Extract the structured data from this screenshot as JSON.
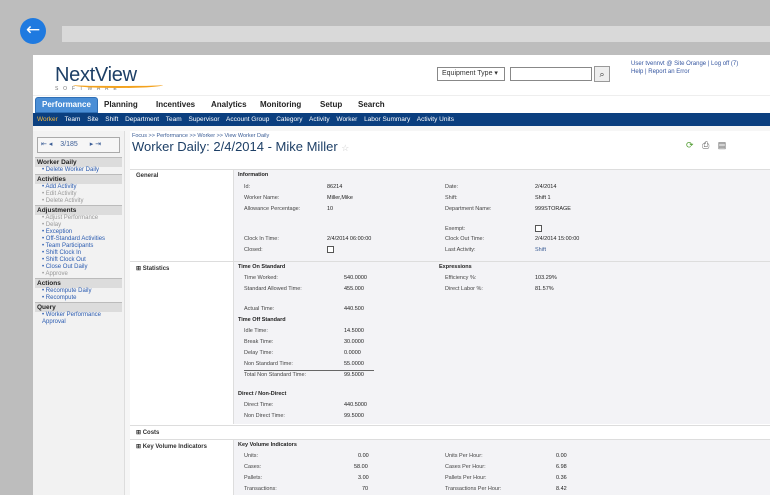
{
  "app": {
    "logo": "NextView",
    "logo_sub": "SOFTWARE",
    "equipment_select": "Equipment Type",
    "user_line1": "User tvennvt @ Site Orange | Log off (7)",
    "user_line2": "Help | Report an Error"
  },
  "nav": {
    "tabs": [
      "Performance",
      "Planning",
      "Incentives",
      "Analytics",
      "Monitoring",
      "Setup",
      "Search"
    ],
    "subtabs": [
      "Worker",
      "Team",
      "Site",
      "Shift",
      "Department",
      "Team",
      "Supervisor",
      "Account Group",
      "Category",
      "Activity",
      "Worker",
      "Labor Summary",
      "Activity Units"
    ]
  },
  "sidebar": {
    "pager": "3/185",
    "sections": [
      {
        "head": "Worker Daily",
        "items": [
          {
            "label": "Delete Worker Daily",
            "enabled": true
          }
        ]
      },
      {
        "head": "Activities",
        "items": [
          {
            "label": "Add Activity",
            "enabled": true
          },
          {
            "label": "Edit Activity",
            "enabled": false
          },
          {
            "label": "Delete Activity",
            "enabled": false
          }
        ]
      },
      {
        "head": "Adjustments",
        "items": [
          {
            "label": "Adjust Performance",
            "enabled": false
          },
          {
            "label": "Delay",
            "enabled": false
          },
          {
            "label": "Exception",
            "enabled": true
          },
          {
            "label": "Off-Standard Activities",
            "enabled": true
          },
          {
            "label": "Team Participants",
            "enabled": true
          },
          {
            "label": "Shift Clock In",
            "enabled": true
          },
          {
            "label": "Shift Clock Out",
            "enabled": true
          },
          {
            "label": "Close Out Daily",
            "enabled": true
          },
          {
            "label": "Approve",
            "enabled": false
          }
        ]
      },
      {
        "head": "Actions",
        "items": [
          {
            "label": "Recompute Daily",
            "enabled": true
          },
          {
            "label": "Recompute",
            "enabled": true
          }
        ]
      },
      {
        "head": "Query",
        "items": [
          {
            "label": "Worker Performance Approval",
            "enabled": true
          }
        ]
      }
    ]
  },
  "main": {
    "breadcrumb": "Focus >> Performance >> Worker >> View Worker Daily",
    "title": "Worker Daily: 2/4/2014 - Mike Miller",
    "general": {
      "section": "General",
      "group": "Information",
      "fields": {
        "id_label": "Id:",
        "id": "86214",
        "worker_label": "Worker Name:",
        "worker": "Miller,Mike",
        "allowance_label": "Allowance Percentage:",
        "allowance": "10",
        "clockin_label": "Clock In Time:",
        "clockin": "2/4/2014 06:00:00",
        "closed_label": "Closed:",
        "date_label": "Date:",
        "date": "2/4/2014",
        "shift_label": "Shift:",
        "shift": "Shift 1",
        "dept_label": "Department Name:",
        "dept": "999STORAGE",
        "exempt_label": "Exempt:",
        "clockout_label": "Clock Out Time:",
        "clockout": "2/4/2014 15:00:00",
        "last_activity_label": "Last Activity:",
        "last_activity": "Shift"
      }
    },
    "statistics": {
      "section": "Statistics",
      "time_on_std": "Time On Standard",
      "time_worked_label": "Time Worked:",
      "time_worked": "540.0000",
      "std_allowed_label": "Standard Allowed Time:",
      "std_allowed": "455.000",
      "actual_label": "Actual Time:",
      "actual": "440.500",
      "time_off_std": "Time Off Standard",
      "idle_label": "Idle Time:",
      "idle": "14.5000",
      "break_label": "Break Time:",
      "break": "30.0000",
      "delay_label": "Delay Time:",
      "delay": "0.0000",
      "nonstd_label": "Non Standard Time:",
      "nonstd": "55.0000",
      "total_nonstd_label": "Total Non Standard Time:",
      "total_nonstd": "99.5000",
      "direct_group": "Direct / Non-Direct",
      "direct_label": "Direct Time:",
      "direct": "440.5000",
      "nondirect_label": "Non Direct Time:",
      "nondirect": "99.5000",
      "expressions": "Expressions",
      "efficiency_label": "Efficiency %:",
      "efficiency": "103.29%",
      "direct_labor_label": "Direct Labor %:",
      "direct_labor": "81.57%"
    },
    "costs": {
      "section": "Costs"
    },
    "kvi": {
      "section": "Key Volume Indicators",
      "group": "Key Volume Indicators",
      "units_label": "Units:",
      "units": "0.00",
      "cases_label": "Cases:",
      "cases": "58.00",
      "pallets_label": "Pallets:",
      "pallets": "3.00",
      "transactions_label": "Transactions:",
      "transactions": "70",
      "uph_label": "Units Per Hour:",
      "uph": "0.00",
      "cph_label": "Cases Per Hour:",
      "cph": "6.98",
      "pph_label": "Pallets Per Hour:",
      "pph": "0.36",
      "tph_label": "Transactions Per Hour:",
      "tph": "8.42"
    }
  }
}
